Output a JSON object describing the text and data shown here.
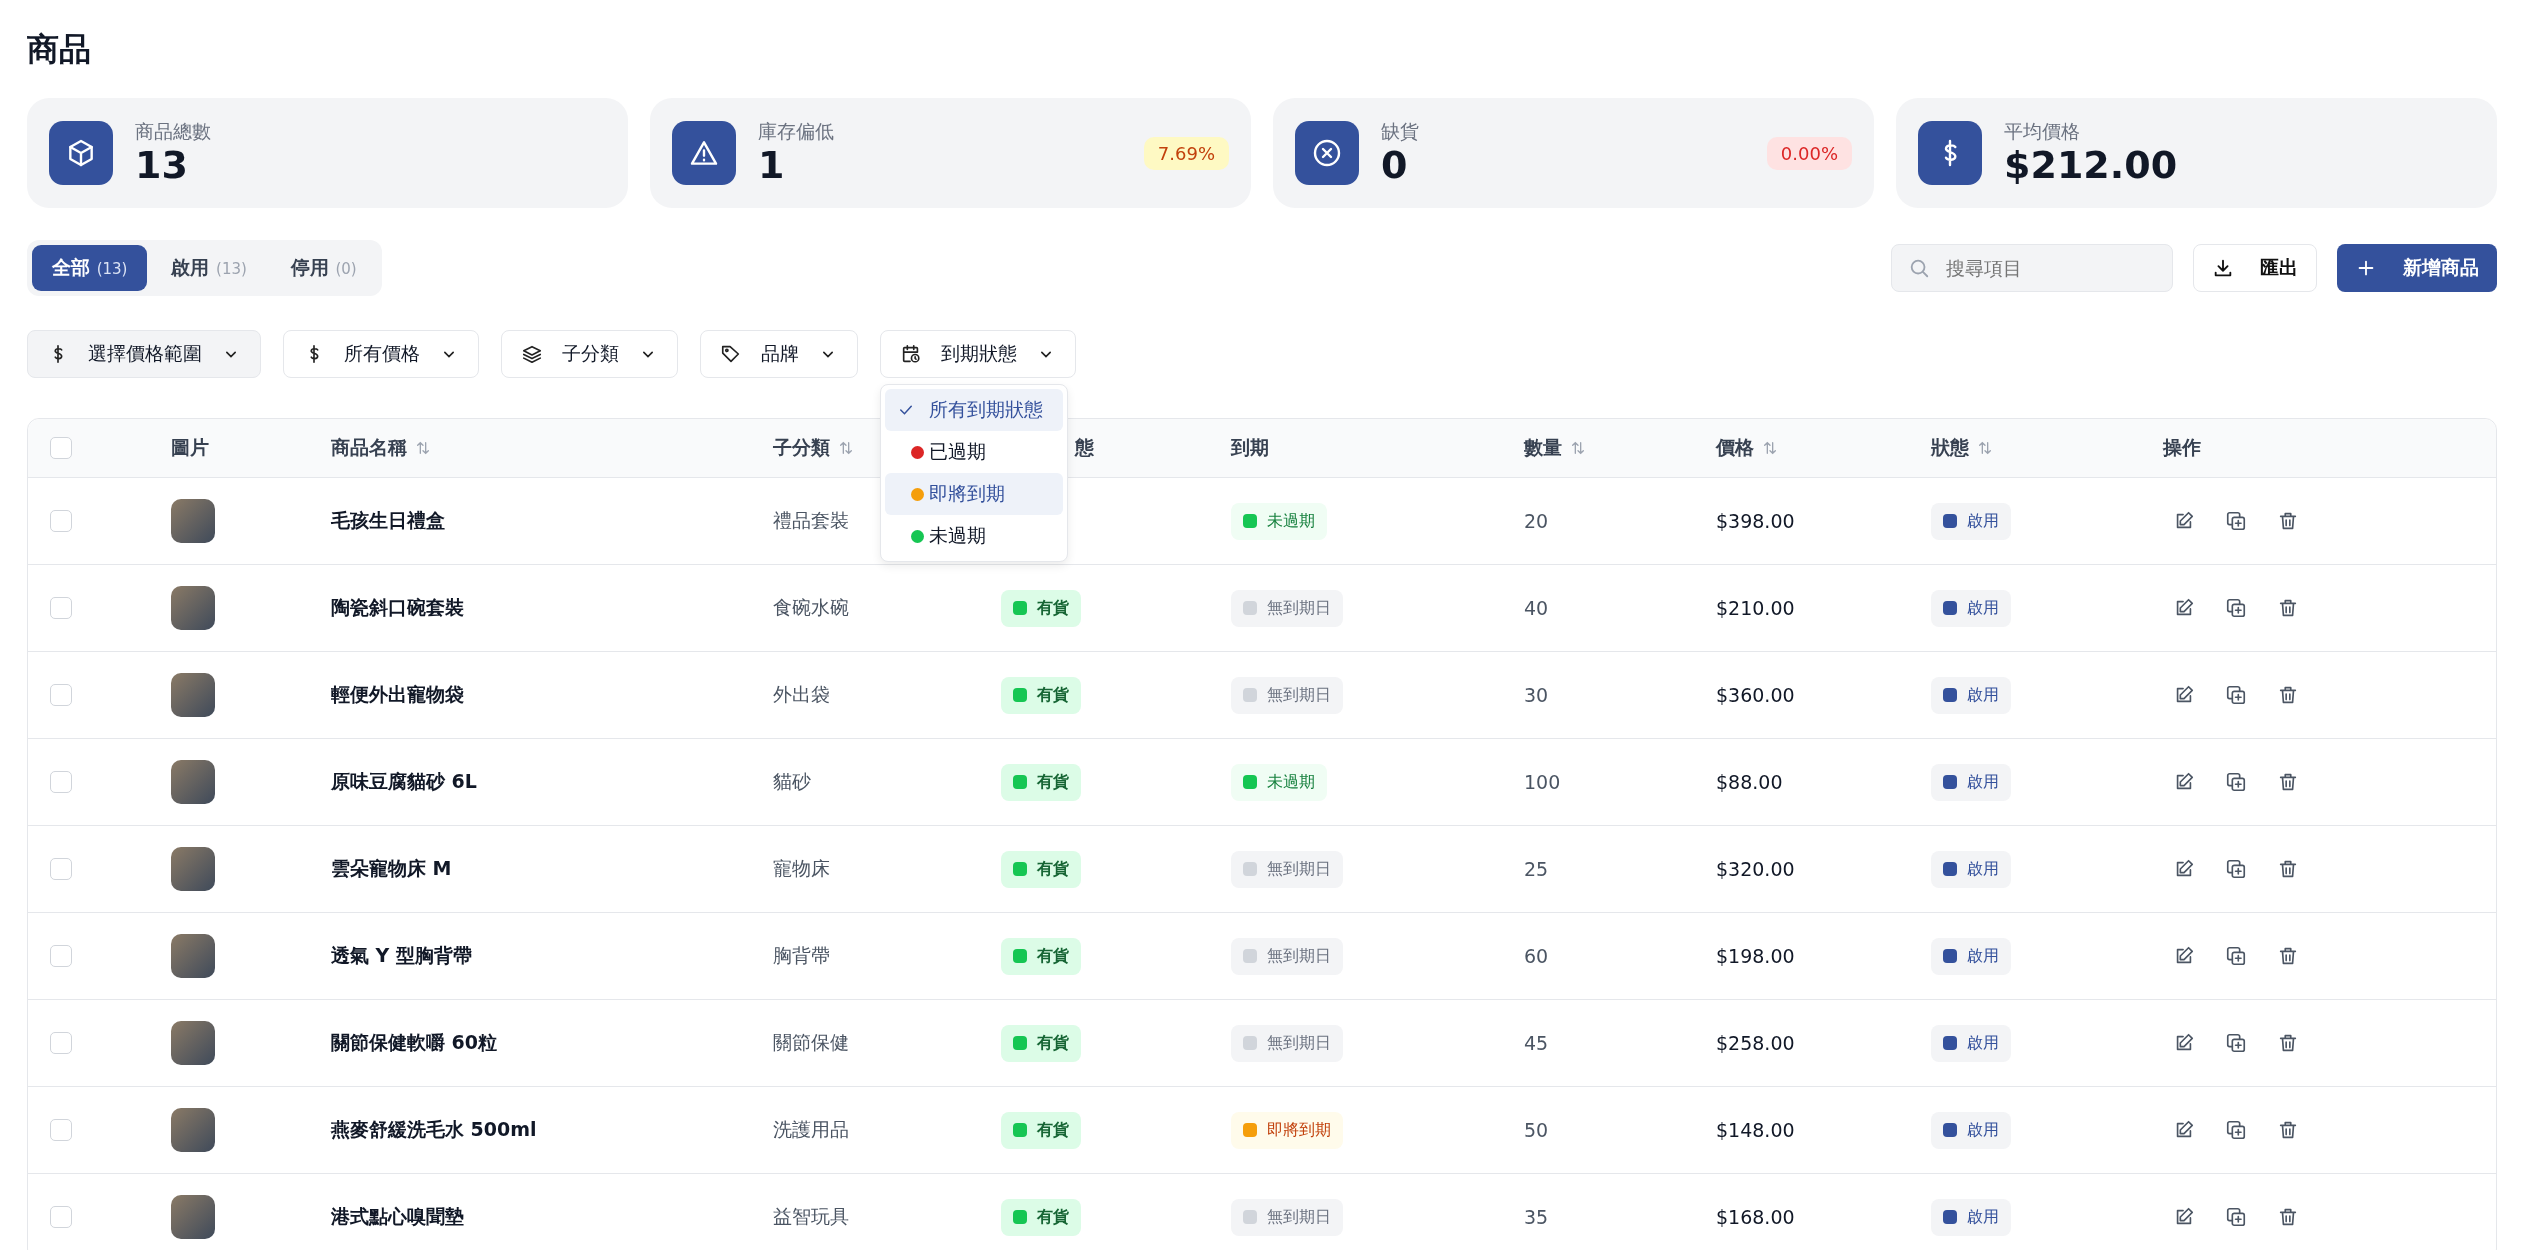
{
  "title": "商品",
  "stats": [
    {
      "label": "商品總數",
      "value": "13"
    },
    {
      "label": "庫存偏低",
      "value": "1",
      "badge": {
        "text": "7.69%",
        "kind": "warning"
      }
    },
    {
      "label": "缺貨",
      "value": "0",
      "badge": {
        "text": "0.00%",
        "kind": "danger"
      }
    },
    {
      "label": "平均價格",
      "value": "$212.00"
    }
  ],
  "tabs": [
    {
      "label": "全部",
      "count": "(13)",
      "selected": true
    },
    {
      "label": "啟用",
      "count": "(13)",
      "selected": false
    },
    {
      "label": "停用",
      "count": "(0)",
      "selected": false
    }
  ],
  "search": {
    "placeholder": "搜尋項目"
  },
  "export_button": "匯出",
  "add_button": "新增商品",
  "filters": [
    {
      "label": "選擇價格範圍",
      "active": true
    },
    {
      "label": "所有價格",
      "active": false
    },
    {
      "label": "子分類",
      "active": false
    },
    {
      "label": "品牌",
      "active": false
    },
    {
      "label": "到期狀態",
      "active": false
    }
  ],
  "expiry_menu": [
    {
      "label": "所有到期狀態",
      "selected": true,
      "hovered": false
    },
    {
      "label": "已過期",
      "color": "#dc2626",
      "selected": false,
      "hovered": false
    },
    {
      "label": "即將到期",
      "color": "#f59e0b",
      "selected": false,
      "hovered": true
    },
    {
      "label": "未過期",
      "color": "#16c653",
      "selected": false,
      "hovered": false
    }
  ],
  "table": {
    "select_all_checked": false,
    "columns": [
      {
        "label": "圖片",
        "sortable": false
      },
      {
        "label": "商品名稱",
        "sortable": true
      },
      {
        "label": "子分類",
        "sortable": true
      },
      {
        "label": "態",
        "sortable": false
      },
      {
        "label": "到期",
        "sortable": false
      },
      {
        "label": "數量",
        "sortable": true
      },
      {
        "label": "價格",
        "sortable": true
      },
      {
        "label": "狀態",
        "sortable": true
      },
      {
        "label": "操作",
        "sortable": false
      }
    ],
    "rows": [
      {
        "name": "毛孩生日禮盒",
        "subcategory": "禮品套裝",
        "expiry": {
          "text": "未過期",
          "kind": "valid"
        },
        "qty": "20",
        "price": "$398.00",
        "status": "啟用",
        "checked": false
      },
      {
        "name": "陶瓷斜口碗套裝",
        "subcategory": "食碗水碗",
        "stock": "有貨",
        "expiry": {
          "text": "無到期日",
          "kind": "none"
        },
        "qty": "40",
        "price": "$210.00",
        "status": "啟用",
        "checked": false
      },
      {
        "name": "輕便外出寵物袋",
        "subcategory": "外出袋",
        "stock": "有貨",
        "expiry": {
          "text": "無到期日",
          "kind": "none"
        },
        "qty": "30",
        "price": "$360.00",
        "status": "啟用",
        "checked": false
      },
      {
        "name": "原味豆腐貓砂 6L",
        "subcategory": "貓砂",
        "stock": "有貨",
        "expiry": {
          "text": "未過期",
          "kind": "valid"
        },
        "qty": "100",
        "price": "$88.00",
        "status": "啟用",
        "checked": false
      },
      {
        "name": "雲朵寵物床 M",
        "subcategory": "寵物床",
        "stock": "有貨",
        "expiry": {
          "text": "無到期日",
          "kind": "none"
        },
        "qty": "25",
        "price": "$320.00",
        "status": "啟用",
        "checked": false
      },
      {
        "name": "透氣 Y 型胸背帶",
        "subcategory": "胸背帶",
        "stock": "有貨",
        "expiry": {
          "text": "無到期日",
          "kind": "none"
        },
        "qty": "60",
        "price": "$198.00",
        "status": "啟用",
        "checked": false
      },
      {
        "name": "關節保健軟嚼 60粒",
        "subcategory": "關節保健",
        "stock": "有貨",
        "expiry": {
          "text": "無到期日",
          "kind": "none"
        },
        "qty": "45",
        "price": "$258.00",
        "status": "啟用",
        "checked": false
      },
      {
        "name": "燕麥舒緩洗毛水 500ml",
        "subcategory": "洗護用品",
        "stock": "有貨",
        "expiry": {
          "text": "即將到期",
          "kind": "soon"
        },
        "qty": "50",
        "price": "$148.00",
        "status": "啟用",
        "checked": false
      },
      {
        "name": "港式點心嗅聞墊",
        "subcategory": "益智玩具",
        "stock": "有貨",
        "expiry": {
          "text": "無到期日",
          "kind": "none"
        },
        "qty": "35",
        "price": "$168.00",
        "status": "啟用",
        "checked": false
      }
    ]
  }
}
